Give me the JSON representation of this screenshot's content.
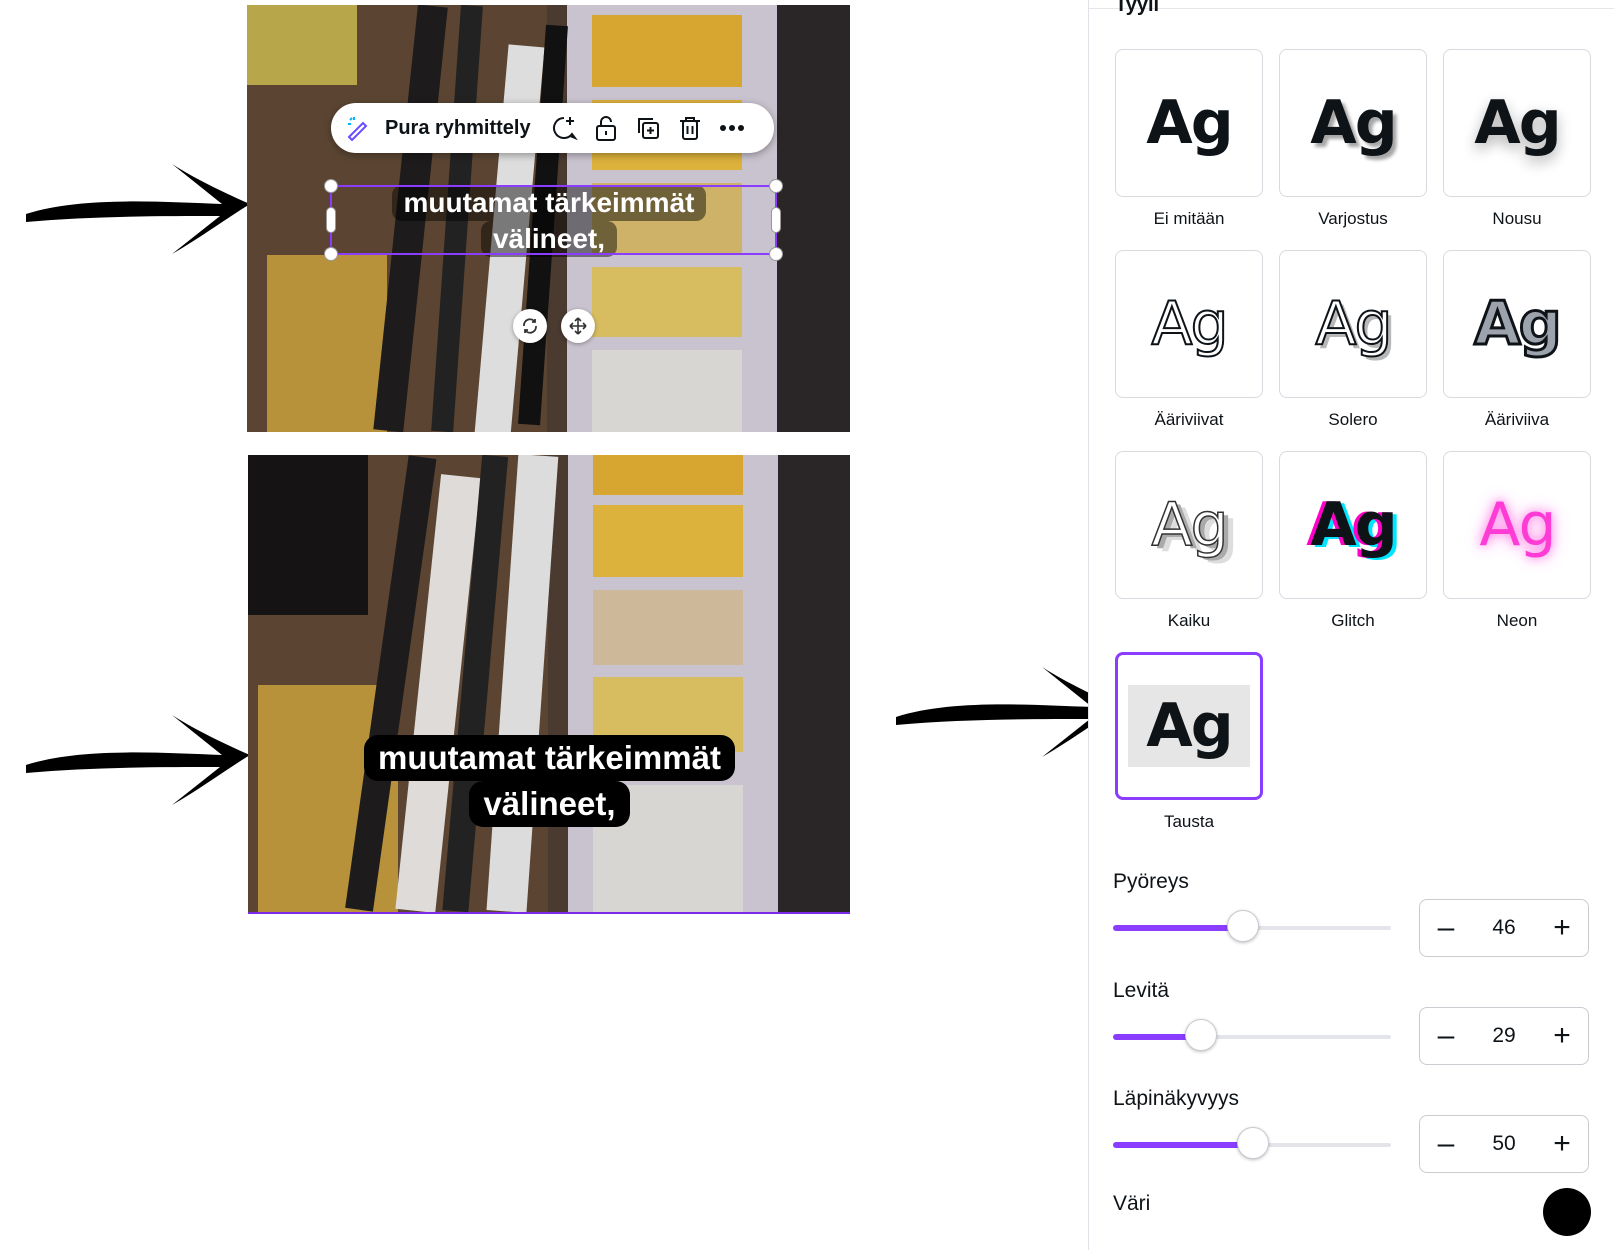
{
  "toolbar": {
    "ungroup_label": "Pura ryhmittely",
    "icons": [
      "magic-edit-icon",
      "comment-add-icon",
      "lock-icon",
      "duplicate-icon",
      "trash-icon",
      "more-icon"
    ]
  },
  "captions": {
    "top": [
      "muutamat tärkeimmät",
      "välineet,"
    ],
    "bottom": [
      "muutamat tärkeimmät",
      "välineet,"
    ]
  },
  "panel": {
    "section_title": "Tyyli",
    "tile_glyph": "Ag",
    "styles": [
      {
        "label": "Ei mitään",
        "selected": false
      },
      {
        "label": "Varjostus",
        "selected": false
      },
      {
        "label": "Nousu",
        "selected": false
      },
      {
        "label": "Ääriviivat",
        "selected": false
      },
      {
        "label": "Solero",
        "selected": false
      },
      {
        "label": "Ääriviiva",
        "selected": false
      },
      {
        "label": "Kaiku",
        "selected": false
      },
      {
        "label": "Glitch",
        "selected": false
      },
      {
        "label": "Neon",
        "selected": false
      },
      {
        "label": "Tausta",
        "selected": true
      }
    ],
    "sliders": [
      {
        "label": "Pyöreys",
        "value": "46"
      },
      {
        "label": "Levitä",
        "value": "29"
      },
      {
        "label": "Läpinäkyvyys",
        "value": "50"
      }
    ],
    "color_label": "Väri",
    "color_value": "#000000"
  },
  "colors": {
    "accent": "#8b3dff"
  }
}
